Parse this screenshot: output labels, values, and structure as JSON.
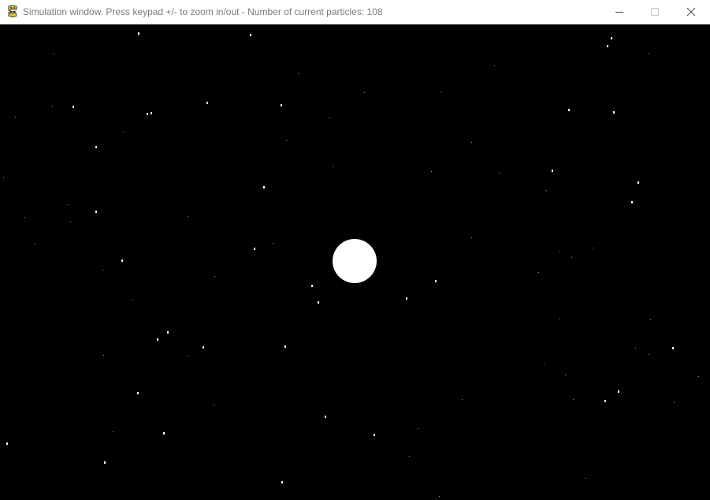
{
  "window": {
    "title": "Simulation window. Press keypad +/- to zoom in/out - Number of current particles: 108",
    "app_icon": "pygame-snake-icon",
    "controls": [
      "minimize-icon",
      "maximize-icon",
      "close-icon"
    ]
  },
  "colors": {
    "titlebar_bg": "#ffffff",
    "title_text": "#7a7a7a",
    "canvas_bg": "#000000",
    "particle": "#ffffff",
    "icon_yellow": "#f4c20d",
    "icon_dark": "#3a3a3a"
  }
}
